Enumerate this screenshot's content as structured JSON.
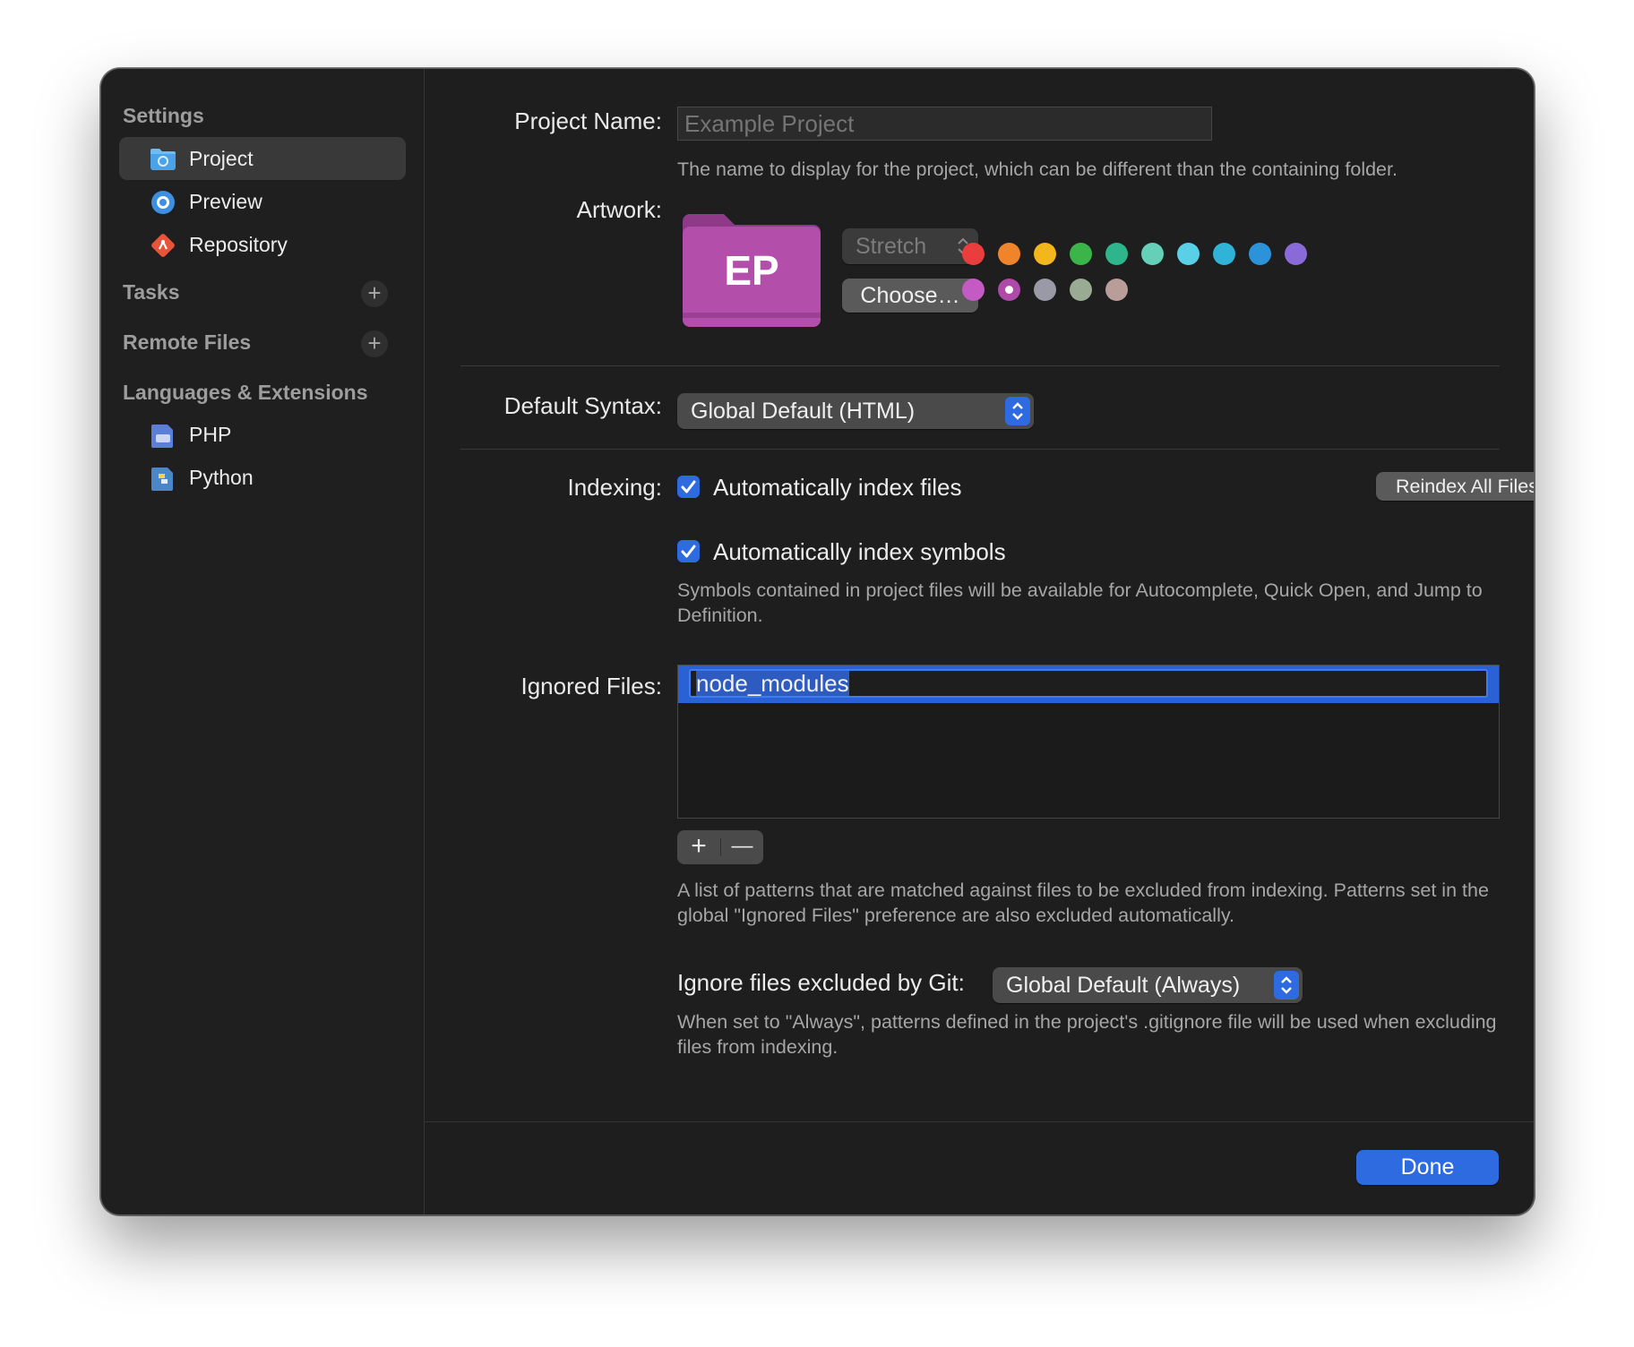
{
  "sidebar": {
    "sections": {
      "settings": "Settings",
      "tasks": "Tasks",
      "remote": "Remote Files",
      "languages": "Languages & Extensions"
    },
    "items": {
      "project": "Project",
      "preview": "Preview",
      "repository": "Repository",
      "php": "PHP",
      "python": "Python"
    },
    "add_symbol": "+"
  },
  "project_name": {
    "label": "Project Name:",
    "placeholder": "Example Project",
    "help": "The name to display for the project, which can be different than the containing folder."
  },
  "artwork": {
    "label": "Artwork:",
    "monogram": "EP",
    "folder_color": "#b04aa8",
    "scaling": "Stretch",
    "choose_button": "Choose…",
    "colors_row1": [
      "#ea3d3d",
      "#f0842b",
      "#f3b71d",
      "#3bb54a",
      "#2fb58b",
      "#66cfb7",
      "#5ad0e6",
      "#2fb3d6",
      "#2d93d9",
      "#8a6ad8"
    ],
    "colors_row2": [
      "#c45bc4",
      "#b04aa8",
      "#9a9aa6",
      "#9aab94",
      "#b89d98"
    ],
    "selected_color": "#b04aa8"
  },
  "default_syntax": {
    "label": "Default Syntax:",
    "value": "Global Default (HTML)"
  },
  "indexing": {
    "label": "Indexing:",
    "index_files": "Automatically index files",
    "index_symbols": "Automatically index symbols",
    "reindex_button": "Reindex All Files",
    "help": "Symbols contained in project files will be available for Autocomplete, Quick Open, and Jump to Definition."
  },
  "ignored_files": {
    "label": "Ignored Files:",
    "entries": [
      "node_modules"
    ],
    "add_symbol": "+",
    "remove_symbol": "—",
    "help": "A list of patterns that are matched against files to be excluded from indexing. Patterns set in the global \"Ignored Files\" preference are also excluded automatically."
  },
  "git_ignore": {
    "label": "Ignore files excluded by Git:",
    "value": "Global Default (Always)",
    "help": "When set to \"Always\", patterns defined in the project's .gitignore file will be used when excluding files from indexing."
  },
  "footer": {
    "done_button": "Done"
  },
  "colors": {
    "accent": "#2f6be0",
    "window_bg": "#1e1e1e"
  }
}
